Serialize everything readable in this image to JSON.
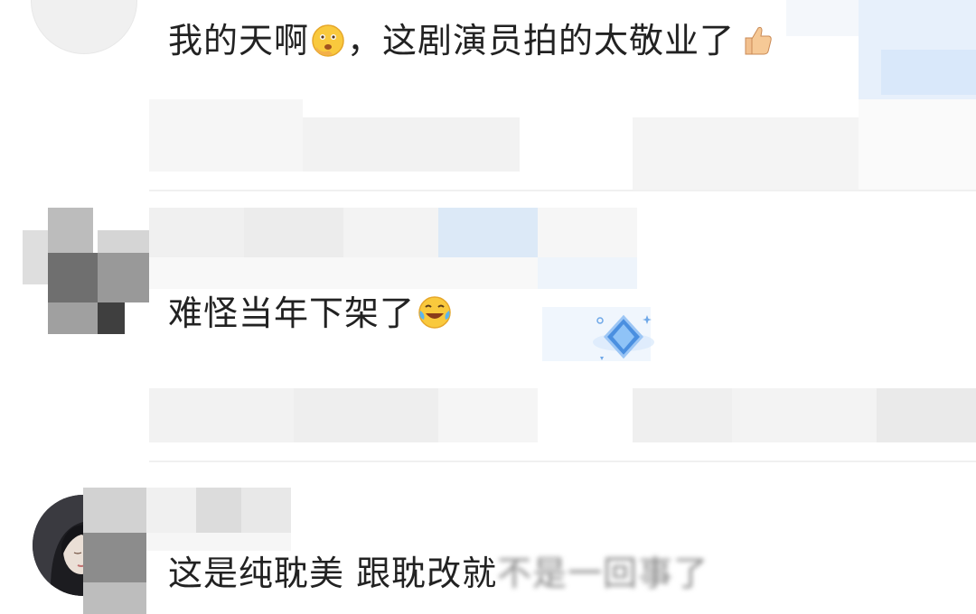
{
  "comments": [
    {
      "text": "我的天啊",
      "text_after_emoji": "，这剧演员拍的太敬业了",
      "emoji_1": "flushed-face-emoji",
      "emoji_2": "thumbs-up-emoji"
    },
    {
      "text": "难怪当年下架了",
      "emoji_1": "laughing-tears-emoji",
      "badge": "diamond-badge-icon"
    },
    {
      "text": "这是纯耽美 跟耽改就",
      "blurred_tail": "不是一回事了"
    }
  ],
  "colors": {
    "text": "#222222",
    "mosaic_gray": "#b8b8b8",
    "mosaic_blue": "#dce9f7",
    "badge_blue": "#4a8fe0"
  }
}
